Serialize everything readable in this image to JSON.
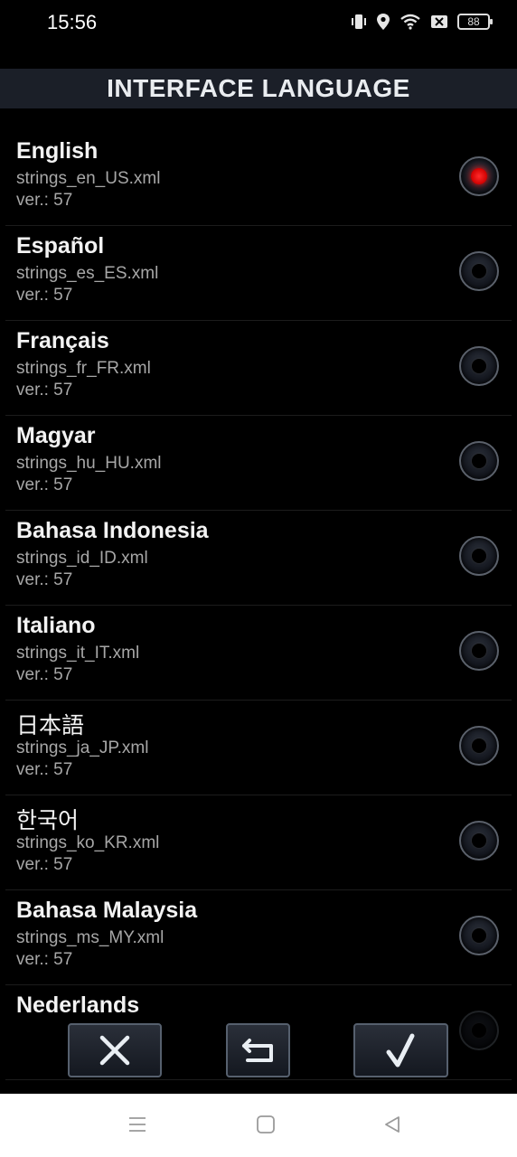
{
  "status_bar": {
    "time": "15:56",
    "battery": "88",
    "icons": [
      "vibrate-icon",
      "location-icon",
      "wifi-icon",
      "sim-off-icon",
      "battery-icon"
    ]
  },
  "header": {
    "title": "INTERFACE LANGUAGE"
  },
  "languages": [
    {
      "name": "English",
      "file": "strings_en_US.xml",
      "version": "ver.: 57",
      "selected": true
    },
    {
      "name": "Español",
      "file": "strings_es_ES.xml",
      "version": "ver.: 57",
      "selected": false
    },
    {
      "name": "Français",
      "file": "strings_fr_FR.xml",
      "version": "ver.: 57",
      "selected": false
    },
    {
      "name": "Magyar",
      "file": "strings_hu_HU.xml",
      "version": "ver.: 57",
      "selected": false
    },
    {
      "name": "Bahasa Indonesia",
      "file": "strings_id_ID.xml",
      "version": "ver.: 57",
      "selected": false
    },
    {
      "name": "Italiano",
      "file": "strings_it_IT.xml",
      "version": "ver.: 57",
      "selected": false
    },
    {
      "name": "日本語",
      "file": "strings_ja_JP.xml",
      "version": "ver.: 57",
      "selected": false
    },
    {
      "name": "한국어",
      "file": "strings_ko_KR.xml",
      "version": "ver.: 57",
      "selected": false
    },
    {
      "name": "Bahasa Malaysia",
      "file": "strings_ms_MY.xml",
      "version": "ver.: 57",
      "selected": false
    },
    {
      "name": "Nederlands",
      "file": "",
      "version": "",
      "selected": false
    }
  ],
  "buttons": {
    "cancel_icon": "close-icon",
    "undo_icon": "undo-icon",
    "ok_icon": "check-icon"
  },
  "colors": {
    "selected_radio": "#ff2020",
    "header_bg": "#1b1f28"
  }
}
